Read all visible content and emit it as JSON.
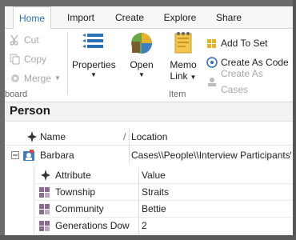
{
  "tabs": [
    "Home",
    "Import",
    "Create",
    "Explore",
    "Share"
  ],
  "clipboard": {
    "cut": "Cut",
    "copy": "Copy",
    "merge": "Merge",
    "group_label": "board"
  },
  "item_group": {
    "properties": "Properties",
    "open": "Open",
    "memo_line1": "Memo",
    "memo_line2": "Link",
    "group_label": "Item"
  },
  "case_actions": {
    "add_to_set": "Add To Set",
    "create_as_code": "Create As Code",
    "create_as_cases": "Create As Cases"
  },
  "section": {
    "title": "Person"
  },
  "grid": {
    "col_name": "Name",
    "col_location": "Location",
    "row": {
      "name": "Barbara",
      "location": "Cases\\\\People\\\\Interview Participants\\"
    }
  },
  "attributes": {
    "col_attribute": "Attribute",
    "col_value": "Value",
    "rows": [
      {
        "attribute": "Township",
        "value": "Straits"
      },
      {
        "attribute": "Community",
        "value": "Bettie"
      },
      {
        "attribute": "Generations Dow",
        "value": "2"
      }
    ]
  },
  "colors": {
    "accent": "#2a6eb5",
    "disabled": "#a8a8a8",
    "attribute_icon": "#8a6d8e"
  }
}
